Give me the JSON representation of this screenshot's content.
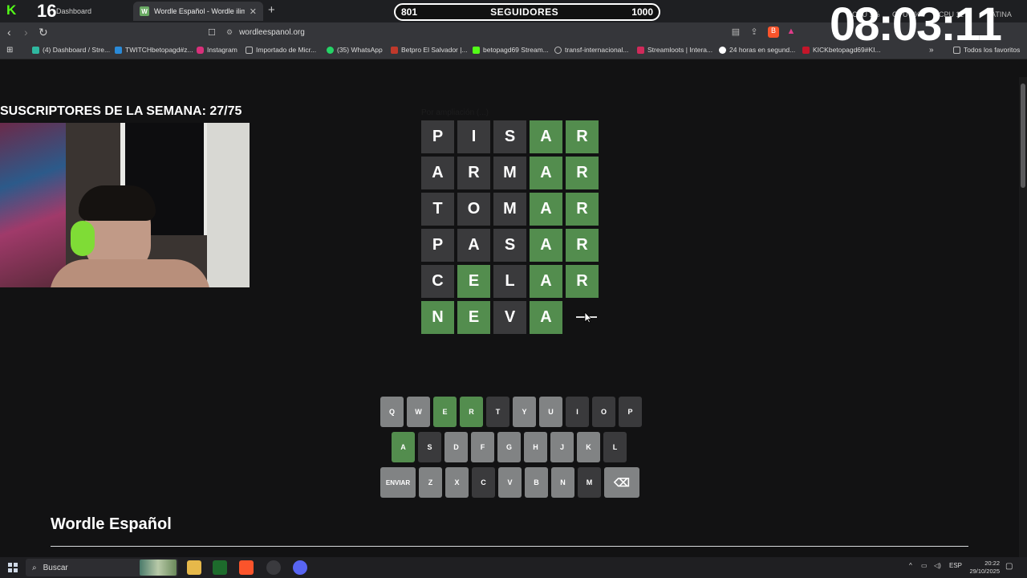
{
  "browser": {
    "overlay_count": "16",
    "tabs": [
      {
        "label": "Dashboard",
        "favicon": "K"
      },
      {
        "label": "Wordle Español - Wordle ilimitado",
        "favicon": "W"
      }
    ],
    "url": "wordleespanol.org",
    "bookmarks": [
      "(4) Dashboard / Stre...",
      "TWITCHbetopagd#z...",
      "Instagram",
      "Importado de Micr...",
      "(35) WhatsApp",
      "Betpro El Salvador |...",
      "betopagd69 Stream...",
      "transf-internacional...",
      "Streamloots | Intera...",
      "24 horas en segund...",
      "KICKbetopagd69#KI..."
    ],
    "all_favorites": "Todos los favoritos"
  },
  "overlay": {
    "followers_current": "801",
    "followers_label": "SEGUIDORES",
    "followers_goal": "1000",
    "timer": "08:03:11",
    "subs_title": "SUSCRIPTORES DE LA SEMANA: 27/75",
    "sys_stats": [
      "CPU 1%",
      "GPU 1%",
      "CPU 11",
      "LATINA"
    ]
  },
  "game": {
    "hidden_label": "Por ampliación (...)",
    "rows": [
      [
        {
          "l": "P",
          "s": "absent"
        },
        {
          "l": "I",
          "s": "absent"
        },
        {
          "l": "S",
          "s": "absent"
        },
        {
          "l": "A",
          "s": "correct"
        },
        {
          "l": "R",
          "s": "correct"
        }
      ],
      [
        {
          "l": "A",
          "s": "absent"
        },
        {
          "l": "R",
          "s": "absent"
        },
        {
          "l": "M",
          "s": "absent"
        },
        {
          "l": "A",
          "s": "correct"
        },
        {
          "l": "R",
          "s": "correct"
        }
      ],
      [
        {
          "l": "T",
          "s": "absent"
        },
        {
          "l": "O",
          "s": "absent"
        },
        {
          "l": "M",
          "s": "absent"
        },
        {
          "l": "A",
          "s": "correct"
        },
        {
          "l": "R",
          "s": "correct"
        }
      ],
      [
        {
          "l": "P",
          "s": "absent"
        },
        {
          "l": "A",
          "s": "absent"
        },
        {
          "l": "S",
          "s": "absent"
        },
        {
          "l": "A",
          "s": "correct"
        },
        {
          "l": "R",
          "s": "correct"
        }
      ],
      [
        {
          "l": "C",
          "s": "absent"
        },
        {
          "l": "E",
          "s": "correct"
        },
        {
          "l": "L",
          "s": "absent"
        },
        {
          "l": "A",
          "s": "correct"
        },
        {
          "l": "R",
          "s": "correct"
        }
      ],
      [
        {
          "l": "N",
          "s": "correct"
        },
        {
          "l": "E",
          "s": "correct"
        },
        {
          "l": "V",
          "s": "absent"
        },
        {
          "l": "A",
          "s": "correct"
        },
        {
          "l": "",
          "s": "empty"
        }
      ]
    ]
  },
  "keyboard": {
    "row1": [
      {
        "k": "Q",
        "s": "unused"
      },
      {
        "k": "W",
        "s": "unused"
      },
      {
        "k": "E",
        "s": "correct"
      },
      {
        "k": "R",
        "s": "correct"
      },
      {
        "k": "T",
        "s": "absent"
      },
      {
        "k": "Y",
        "s": "unused"
      },
      {
        "k": "U",
        "s": "unused"
      },
      {
        "k": "I",
        "s": "absent"
      },
      {
        "k": "O",
        "s": "absent"
      },
      {
        "k": "P",
        "s": "absent"
      }
    ],
    "row2": [
      {
        "k": "A",
        "s": "correct"
      },
      {
        "k": "S",
        "s": "absent"
      },
      {
        "k": "D",
        "s": "unused"
      },
      {
        "k": "F",
        "s": "unused"
      },
      {
        "k": "G",
        "s": "unused"
      },
      {
        "k": "H",
        "s": "unused"
      },
      {
        "k": "J",
        "s": "unused"
      },
      {
        "k": "K",
        "s": "unused"
      },
      {
        "k": "L",
        "s": "absent"
      }
    ],
    "row3": [
      {
        "k": "ENVIAR",
        "s": "unused"
      },
      {
        "k": "Z",
        "s": "unused"
      },
      {
        "k": "X",
        "s": "unused"
      },
      {
        "k": "C",
        "s": "absent"
      },
      {
        "k": "V",
        "s": "unused"
      },
      {
        "k": "B",
        "s": "unused"
      },
      {
        "k": "N",
        "s": "unused"
      },
      {
        "k": "M",
        "s": "absent"
      },
      {
        "k": "⌫",
        "s": "unused"
      }
    ]
  },
  "page": {
    "title": "Wordle Español"
  },
  "taskbar": {
    "search": "Buscar",
    "lang": "ESP",
    "time": "20:22",
    "date": "29/10/2025"
  },
  "colors": {
    "correct": "#538d4e",
    "absent": "#3a3a3c",
    "unused": "#818384",
    "kick_green": "#53fc18"
  }
}
